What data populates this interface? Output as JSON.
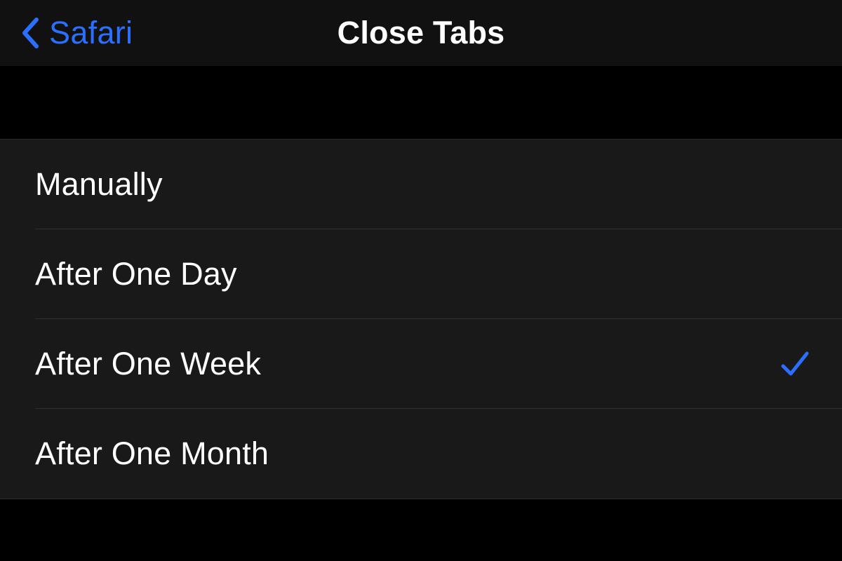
{
  "nav": {
    "back_label": "Safari",
    "title": "Close Tabs"
  },
  "colors": {
    "accent": "#2b6fff",
    "row_bg": "#191919",
    "page_bg": "#000000",
    "text": "#ffffff",
    "separator": "#303030"
  },
  "options": [
    {
      "label": "Manually",
      "selected": false
    },
    {
      "label": "After One Day",
      "selected": false
    },
    {
      "label": "After One Week",
      "selected": true
    },
    {
      "label": "After One Month",
      "selected": false
    }
  ]
}
